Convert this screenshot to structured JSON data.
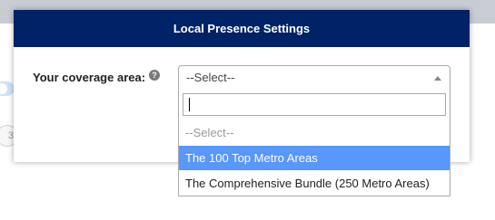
{
  "modal": {
    "title": "Local Presence Settings"
  },
  "form": {
    "coverage_label": "Your coverage area:",
    "help_icon": "help-question-icon",
    "help_glyph": "?"
  },
  "select": {
    "current_value": "--Select--",
    "search_value": ""
  },
  "dropdown": {
    "options": [
      {
        "label": "--Select--"
      },
      {
        "label": "The 100 Top Metro Areas"
      },
      {
        "label": "The Comprehensive Bundle (250 Metro Areas)"
      }
    ],
    "highlighted_index": 1
  },
  "background": {
    "partial_badge": "3"
  },
  "colors": {
    "header_bg": "#002266",
    "highlight_bg": "#5897fb"
  }
}
